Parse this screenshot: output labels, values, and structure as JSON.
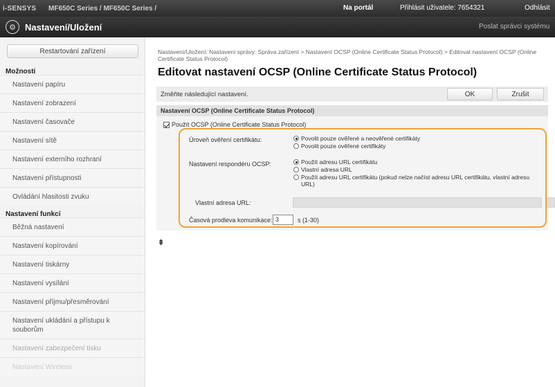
{
  "topbar": {
    "brand": "i-SENSYS",
    "model": "MF650C Series / MF650C Series /",
    "portal": "Na portál",
    "user": "Přihlásit uživatele:  7654321",
    "logout": "Odhlásit"
  },
  "header": {
    "title": "Nastavení/Uložení",
    "mail_link": "Poslat správci systému"
  },
  "sidebar": {
    "restart_label": "Restartování zařízení",
    "section_options": "Možnosti",
    "options_items": [
      "Nastavení papíru",
      "Nastavení zobrazení",
      "Nastavení časovače",
      "Nastavení sítě",
      "Nastavení externího rozhraní",
      "Nastavení přístupnosti",
      "Ovládání hlasitosti zvuku"
    ],
    "section_functions": "Nastavení funkcí",
    "function_items": [
      "Běžná nastavení",
      "Nastavení kopírování",
      "Nastavení tiskárny",
      "Nastavení vysílání",
      "Nastavení příjmu/přesměrování",
      "Nastavení ukládání a přístupu k souborům",
      "Nastavení zabezpečení tisku",
      "Nastavení Wireless"
    ]
  },
  "main": {
    "breadcrumb": "Nastavení/Uložení: Nastavení správy: Správa zařízení > Nastavení OCSP (Online Certificate Status Protocol) > Editovat nastavení OCSP (Online Certificate Status Protocol)",
    "title": "Editovat nastavení OCSP (Online Certificate Status Protocol)",
    "instruction": "Změňte následující nastavení.",
    "ok_label": "OK",
    "cancel_label": "Zrušit",
    "section_title": "Nastavení OCSP (Online Certificate Status Protocol)",
    "use_ocsp_label": "Použít OCSP (Online Certificate Status Protocol)",
    "use_ocsp_checked": true,
    "verification_level": {
      "label": "Úroveň ověření certifikátu:",
      "options": [
        "Povolit pouze ověřené a neověřené certifikáty",
        "Povolit pouze ověřené certifikáty"
      ],
      "selected": 0
    },
    "responder": {
      "label": "Nastavení respondéru OCSP:",
      "options": [
        "Použít adresu URL certifikátu",
        "Vlastní adresa URL",
        "Použít adresu URL certifikátu (pokud nelze načíst adresu URL certifikátu, vlastní adresu URL)"
      ],
      "selected": 0
    },
    "custom_url": {
      "label": "Vlastní adresa URL:",
      "value": ""
    },
    "timeout": {
      "label": "Časová prodleva komunikace:",
      "value": "3",
      "unit": "s (1-30)"
    },
    "top_link": "⇞"
  },
  "colors": {
    "highlight": "#f0a330",
    "header_bg": "#2c2c2c"
  }
}
